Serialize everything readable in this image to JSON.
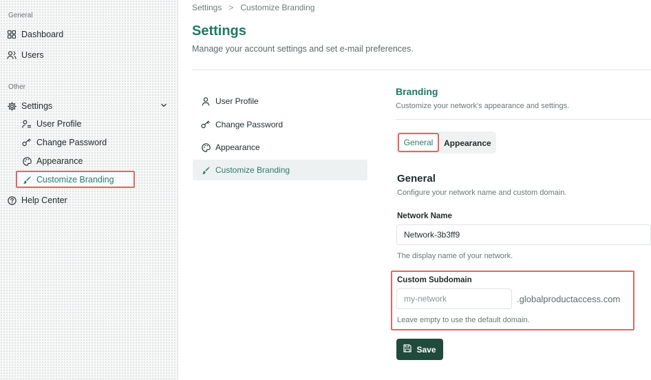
{
  "sidebar": {
    "general_label": "General",
    "other_label": "Other",
    "items": {
      "dashboard": "Dashboard",
      "users": "Users",
      "settings": "Settings",
      "user_profile": "User Profile",
      "change_password": "Change Password",
      "appearance": "Appearance",
      "customize_branding": "Customize Branding",
      "help_center": "Help Center"
    }
  },
  "breadcrumb": {
    "root": "Settings",
    "separator": ">",
    "current": "Customize Branding"
  },
  "page": {
    "title": "Settings",
    "subtitle": "Manage your account settings and set e-mail preferences."
  },
  "settings_menu": {
    "user_profile": "User Profile",
    "change_password": "Change Password",
    "appearance": "Appearance",
    "customize_branding": "Customize Branding"
  },
  "branding": {
    "title": "Branding",
    "subtitle": "Customize your network's appearance and settings.",
    "tabs": {
      "general": "General",
      "appearance": "Appearance"
    }
  },
  "general_section": {
    "title": "General",
    "subtitle": "Configure your network name and custom domain.",
    "network_name_label": "Network Name",
    "network_name_value": "Network-3b3ff9",
    "network_name_help": "The display name of your network.",
    "subdomain_label": "Custom Subdomain",
    "subdomain_placeholder": "my-network",
    "subdomain_suffix": ".globalproductaccess.com",
    "subdomain_help": "Leave empty to use the default domain.",
    "save_label": "Save"
  },
  "colors": {
    "accent": "#1b7a63",
    "save_button": "#1f4a3c",
    "highlight": "#e26565"
  }
}
